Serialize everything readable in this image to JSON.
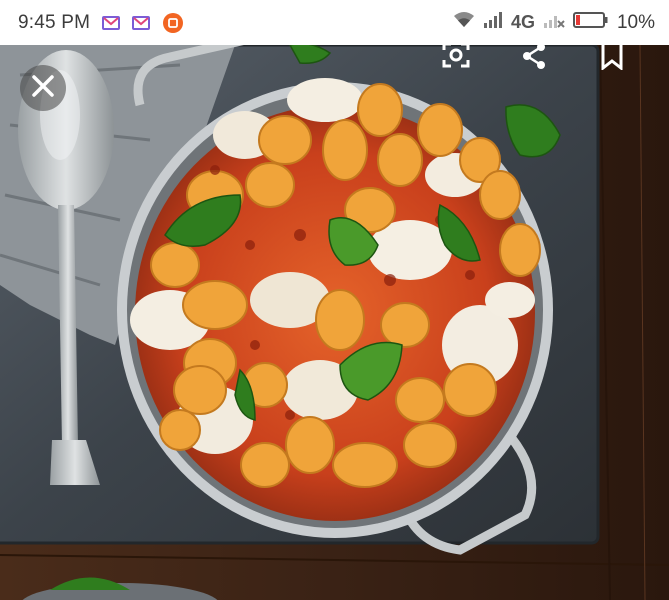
{
  "status_bar": {
    "time": "9:45 PM",
    "network": "4G",
    "battery": "10%",
    "notification_icons": [
      "mail-icon",
      "mail-icon",
      "app-notification-icon"
    ]
  },
  "viewer": {
    "icons": [
      "close-icon",
      "lens-icon",
      "share-icon",
      "bookmark-icon"
    ]
  },
  "colors": {
    "statusbar_bg": "#ffffff",
    "battery_low": "#e53935",
    "notification_orange": "#f26522"
  }
}
